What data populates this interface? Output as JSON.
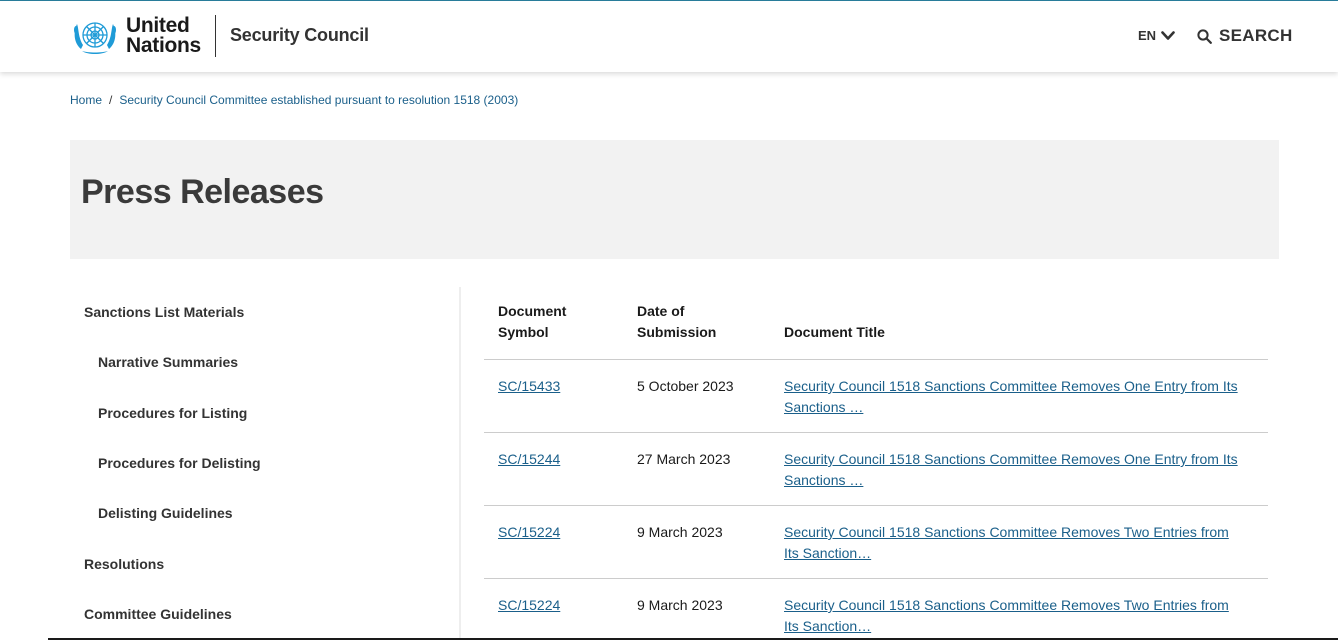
{
  "header": {
    "logo_line1": "United",
    "logo_line2": "Nations",
    "site_name": "Security Council",
    "language": "EN",
    "search_label": "SEARCH"
  },
  "breadcrumb": {
    "home": "Home",
    "separator": "/",
    "current": "Security Council Committee established pursuant to resolution 1518 (2003)"
  },
  "page_title": "Press Releases",
  "sidebar": {
    "items": [
      {
        "label": "Sanctions List Materials"
      },
      {
        "label": "Narrative Summaries"
      },
      {
        "label": "Procedures for Listing"
      },
      {
        "label": "Procedures for Delisting"
      },
      {
        "label": "Delisting Guidelines"
      },
      {
        "label": "Resolutions"
      },
      {
        "label": "Committee Guidelines"
      }
    ]
  },
  "table": {
    "headers": {
      "symbol_line1": "Document",
      "symbol_line2": "Symbol",
      "date_line1": "Date of",
      "date_line2": "Submission",
      "title": "Document Title"
    },
    "rows": [
      {
        "symbol": "SC/15433",
        "date": "5 October 2023",
        "title_line1": "Security Council 1518 Sanctions Committee Removes One Entry from Its",
        "title_line2": "Sanctions …"
      },
      {
        "symbol": "SC/15244",
        "date": "27 March 2023",
        "title_line1": "Security Council 1518 Sanctions Committee Removes One Entry from Its",
        "title_line2": "Sanctions …"
      },
      {
        "symbol": "SC/15224",
        "date": "9 March 2023",
        "title_line1": "Security Council 1518 Sanctions Committee Removes Two Entries from",
        "title_line2": "Its Sanction…"
      },
      {
        "symbol": "SC/15224",
        "date": "9 March 2023",
        "title_line1": "Security Council 1518 Sanctions Committee Removes Two Entries from",
        "title_line2": "Its Sanction…"
      }
    ]
  },
  "colors": {
    "link": "#1a5f8a",
    "un_blue": "#1f9bd7",
    "title_band": "#f2f2f2"
  }
}
